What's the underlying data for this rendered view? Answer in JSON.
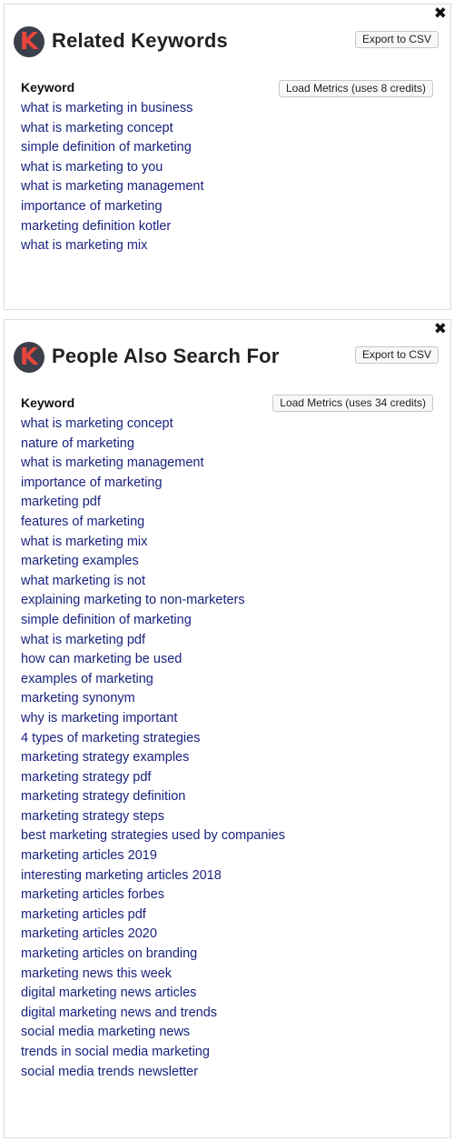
{
  "related": {
    "title": "Related Keywords",
    "logo_letter": "K",
    "close_glyph": "✖",
    "export_label": "Export to CSV",
    "column_header": "Keyword",
    "load_metrics_label": "Load Metrics (uses 8 credits)",
    "keywords": [
      "what is marketing in business",
      "what is marketing concept",
      "simple definition of marketing",
      "what is marketing to you",
      "what is marketing management",
      "importance of marketing",
      "marketing definition kotler",
      "what is marketing mix"
    ]
  },
  "people_also": {
    "title": "People Also Search For",
    "logo_letter": "K",
    "close_glyph": "✖",
    "export_label": "Export to CSV",
    "column_header": "Keyword",
    "load_metrics_label": "Load Metrics (uses 34 credits)",
    "keywords": [
      "what is marketing concept",
      "nature of marketing",
      "what is marketing management",
      "importance of marketing",
      "marketing pdf",
      "features of marketing",
      "what is marketing mix",
      "marketing examples",
      "what marketing is not",
      "explaining marketing to non-marketers",
      "simple definition of marketing",
      "what is marketing pdf",
      "how can marketing be used",
      "examples of marketing",
      "marketing synonym",
      "why is marketing important",
      "4 types of marketing strategies",
      "marketing strategy examples",
      "marketing strategy pdf",
      "marketing strategy definition",
      "marketing strategy steps",
      "best marketing strategies used by companies",
      "marketing articles 2019",
      "interesting marketing articles 2018",
      "marketing articles forbes",
      "marketing articles pdf",
      "marketing articles 2020",
      "marketing articles on branding",
      "marketing news this week",
      "digital marketing news articles",
      "digital marketing news and trends",
      "social media marketing news",
      "trends in social media marketing",
      "social media trends newsletter"
    ]
  },
  "colors": {
    "link": "#1a237e",
    "logo_bg": "#3b3f4a",
    "logo_letter": "#e8453c"
  },
  "icons": {
    "logo": "keywords-k-logo-icon",
    "close": "close-x-icon"
  }
}
